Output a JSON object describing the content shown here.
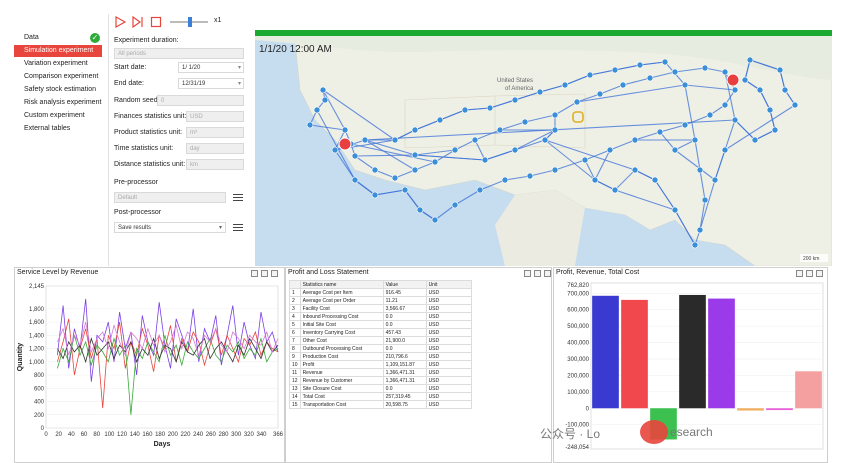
{
  "toolbar": {
    "speed_label": "x1"
  },
  "sidebar": {
    "items": [
      {
        "label": "Data"
      },
      {
        "label": "Simulation experiment"
      },
      {
        "label": "Variation experiment"
      },
      {
        "label": "Comparison experiment"
      },
      {
        "label": "Safety stock estimation"
      },
      {
        "label": "Risk analysis experiment"
      },
      {
        "label": "Custom experiment"
      },
      {
        "label": "External tables"
      }
    ]
  },
  "settings": {
    "experiment_duration_label": "Experiment duration:",
    "duration_placeholder": "All periods",
    "start_date_label": "Start date:",
    "start_date_value": "1/ 1/20",
    "end_date_label": "End date:",
    "end_date_value": "12/31/19",
    "random_seed_label": "Random seed:",
    "random_seed_value": "0",
    "finances_unit_label": "Finances statistics unit:",
    "finances_unit_value": "USD",
    "product_unit_label": "Product statistics unit:",
    "product_unit_value": "m³",
    "time_unit_label": "Time statistics unit:",
    "time_unit_value": "day",
    "distance_unit_label": "Distance statistics unit:",
    "distance_unit_value": "km",
    "preprocessor_label": "Pre-processor",
    "preprocessor_value": "Default",
    "postprocessor_label": "Post-processor",
    "postprocessor_value": "Save results"
  },
  "map": {
    "timestamp": "1/1/20 12:00 AM",
    "country_label_1": "United States",
    "country_label_2": "of America",
    "scale_label": "200 km",
    "colors": {
      "route": "#3a6fd8",
      "node": "#3a8fd8",
      "dc": "#e84040",
      "warehouse": "#e0b020",
      "progress": "#1aaa32"
    }
  },
  "panels": {
    "service_title": "Service Level by Revenue",
    "pl_title": "Profit and Loss Statement",
    "prc_title": "Profit, Revenue, Total Cost"
  },
  "pl_table": {
    "headers": [
      "",
      "Statistics name",
      "Value",
      "Unit"
    ],
    "rows": [
      [
        "1",
        "Average Cost per Item",
        "916.45",
        "USD"
      ],
      [
        "2",
        "Average Cost per Order",
        "11.21",
        "USD"
      ],
      [
        "3",
        "Facility Cost",
        "3,566.67",
        "USD"
      ],
      [
        "4",
        "Inbound Processing Cost",
        "0.0",
        "USD"
      ],
      [
        "5",
        "Initial Site Cost",
        "0.0",
        "USD"
      ],
      [
        "6",
        "Inventory Carrying Cost",
        "457.43",
        "USD"
      ],
      [
        "7",
        "Other Cost",
        "21,900.0",
        "USD"
      ],
      [
        "8",
        "Outbound Processing Cost",
        "0.0",
        "USD"
      ],
      [
        "9",
        "Production Cost",
        "210,796.6",
        "USD"
      ],
      [
        "10",
        "Profit",
        "1,109,151.87",
        "USD"
      ],
      [
        "11",
        "Revenue",
        "1,366,471.31",
        "USD"
      ],
      [
        "12",
        "Revenue by Customer",
        "1,366,471.31",
        "USD"
      ],
      [
        "13",
        "Site Closure Cost",
        "0.0",
        "USD"
      ],
      [
        "14",
        "Total Cost",
        "257,319.45",
        "USD"
      ],
      [
        "15",
        "Transportation Cost",
        "20,598.75",
        "USD"
      ]
    ]
  },
  "watermark": {
    "text1": "公众号 · Lo",
    "text2": "esearch"
  },
  "chart_data": [
    {
      "type": "line",
      "title": "Service Level by Revenue",
      "xlabel": "Days",
      "ylabel": "Quantity",
      "xlim": [
        0,
        366
      ],
      "ylim": [
        0,
        2145
      ],
      "xticks": [
        0,
        20,
        40,
        60,
        80,
        100,
        120,
        140,
        160,
        180,
        200,
        220,
        240,
        260,
        280,
        300,
        320,
        340,
        366
      ],
      "yticks": [
        0,
        200,
        400,
        600,
        800,
        1000,
        1200,
        1400,
        1600,
        1800,
        2145
      ],
      "ytick_labels": [
        "0",
        "200",
        "400",
        "600",
        "800",
        "1,000",
        "1,200",
        "1,400",
        "1,600",
        "1,800",
        "2,145"
      ],
      "series": [
        {
          "color": "#7b3fe4",
          "values": [
            1100,
            1850,
            900,
            1500,
            1200,
            1950,
            700,
            1400,
            1300,
            1600,
            1000,
            1750,
            1200,
            1450,
            800,
            1700,
            1300,
            1100,
            1900,
            1250,
            900,
            1650,
            1400,
            1150,
            1800,
            1000,
            1500,
            1300,
            1700,
            950,
            1400,
            1850,
            1100,
            1600,
            1250,
            1050,
            1750,
            1300,
            1450,
            1150
          ]
        },
        {
          "color": "#e8453c",
          "values": [
            1000,
            1300,
            1650,
            800,
            1200,
            1500,
            1050,
            1350,
            300,
            1400,
            1200,
            1600,
            900,
            1300,
            1100,
            1500,
            1250,
            850,
            1400,
            1200,
            1550,
            1000,
            1350,
            1150,
            1450,
            1300,
            950,
            1250,
            1500,
            1100,
            1400,
            1200,
            1000,
            1350,
            1250,
            1450,
            1100,
            1300,
            1200,
            1150
          ]
        },
        {
          "color": "#3aaa3a",
          "values": [
            900,
            1200,
            1000,
            1400,
            1100,
            1300,
            950,
            1250,
            1150,
            1000,
            1350,
            1100,
            1250,
            200,
            1200,
            1050,
            1300,
            1150,
            1000,
            1400,
            1100,
            1250,
            950,
            1300,
            1150,
            1050,
            1200,
            1350,
            1100,
            1000,
            1250,
            1150,
            1300,
            1050,
            1200,
            1100,
            1350,
            1000,
            1150,
            1200
          ]
        },
        {
          "color": "#333333",
          "values": [
            1200,
            1050,
            1300,
            1150,
            1250,
            1000,
            1350,
            1100,
            1200,
            1300,
            1050,
            1250,
            1150,
            1300,
            1000,
            1200,
            1100,
            1350,
            1050,
            1250,
            1200,
            1000,
            1300,
            1150,
            1100,
            1250,
            1350,
            1050,
            1200,
            1300,
            1150,
            1000,
            1250,
            1100,
            1350,
            1200,
            1050,
            1300,
            1150,
            1250
          ]
        },
        {
          "color": "#d87ad8",
          "values": [
            1300,
            1500,
            1100,
            1400,
            1250,
            1600,
            1150,
            1350,
            1450,
            1200,
            1550,
            1300,
            1100,
            1450,
            1350,
            1200,
            1500,
            1250,
            1400,
            1150,
            1300,
            1550,
            1200,
            1450,
            1350,
            1100,
            1400,
            1300,
            1500,
            1250,
            1150,
            1450,
            1350,
            1200,
            1400,
            1300,
            1250,
            1450,
            1150,
            1350
          ]
        }
      ]
    },
    {
      "type": "bar",
      "title": "Profit, Revenue, Total Cost",
      "ylim": [
        -248054,
        762820
      ],
      "yticks": [
        -100000,
        0,
        100000,
        200000,
        300000,
        400000,
        500000,
        600000,
        700000
      ],
      "ytick_labels": [
        "-100,000",
        "0",
        "100,000",
        "200,000",
        "300,000",
        "400,000",
        "500,000",
        "600,000",
        "700,000"
      ],
      "ymax_label": "762,820",
      "ymin_label": "-248,054",
      "values": [
        685000,
        660000,
        -190000,
        690000,
        668000,
        -14000,
        -11000,
        225000
      ],
      "colors": [
        "#3a3ad0",
        "#f0484c",
        "#3cc050",
        "#2a2a2a",
        "#9a3ae8",
        "#f0b060",
        "#e860d8",
        "#f4a0a0"
      ]
    }
  ]
}
